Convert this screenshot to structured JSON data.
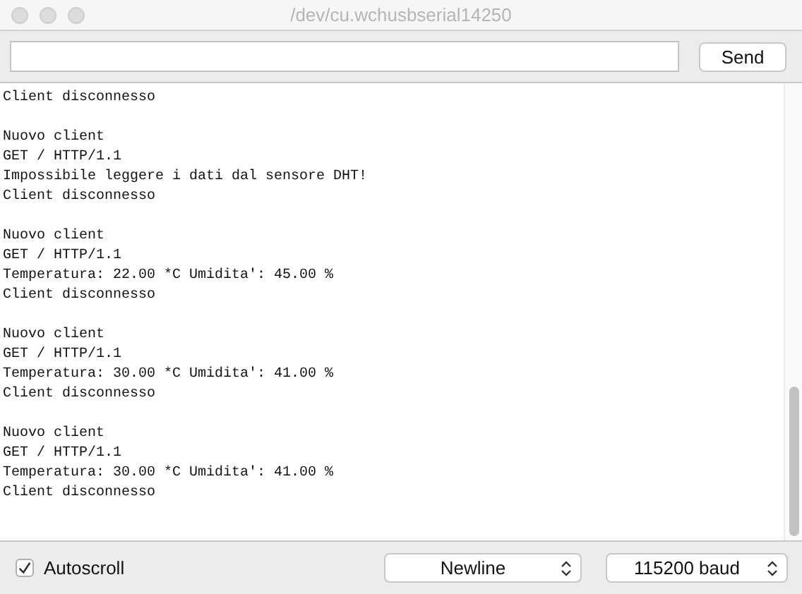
{
  "window": {
    "title": "/dev/cu.wchusbserial14250"
  },
  "toolbar": {
    "send_button": "Send"
  },
  "output": {
    "blocks": [
      [
        "Client disconnesso"
      ],
      [
        "Nuovo client",
        "GET / HTTP/1.1",
        "Impossibile leggere i dati dal sensore DHT!",
        "Client disconnesso"
      ],
      [
        "Nuovo client",
        "GET / HTTP/1.1",
        "Temperatura: 22.00 *C Umidita': 45.00 %",
        "Client disconnesso"
      ],
      [
        "Nuovo client",
        "GET / HTTP/1.1",
        "Temperatura: 30.00 *C Umidita': 41.00 %",
        "Client disconnesso"
      ],
      [
        "Nuovo client",
        "GET / HTTP/1.1",
        "Temperatura: 30.00 *C Umidita': 41.00 %",
        "Client disconnesso"
      ]
    ]
  },
  "footer": {
    "autoscroll": {
      "label": "Autoscroll",
      "checked": true
    },
    "line_ending": "Newline",
    "baud_rate": "115200 baud"
  }
}
